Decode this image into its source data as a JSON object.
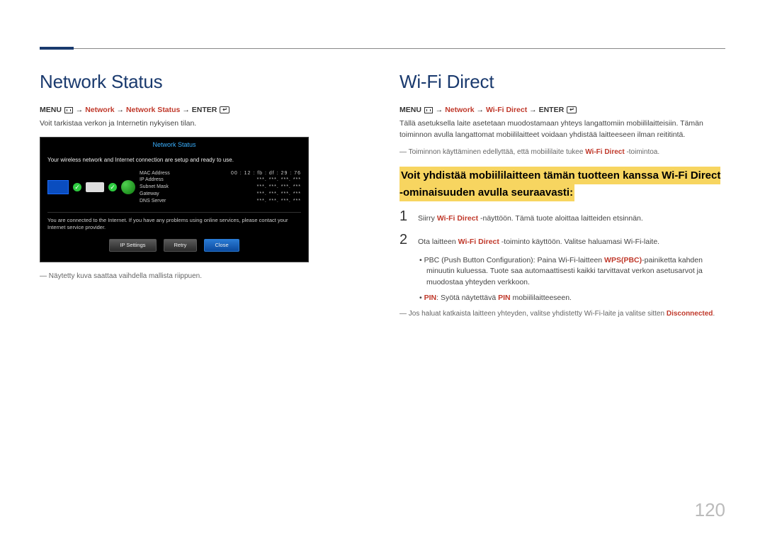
{
  "pageNumber": "120",
  "left": {
    "heading": "Network Status",
    "menuPath": {
      "prefix": "MENU ",
      "arrow": " → ",
      "net": "Network",
      "item": "Network Status",
      "enter": "ENTER"
    },
    "desc": "Voit tarkistaa verkon ja Internetin nykyisen tilan.",
    "note": "Näytetty kuva saattaa vaihdella mallista riippuen.",
    "window": {
      "title": "Network Status",
      "line1": "Your wireless network and Internet connection are setup and ready to use.",
      "info": {
        "mac_label": "MAC Address",
        "mac_val": "00 : 12 : fb : df : 29 : 76",
        "ip_label": "IP Address",
        "ip_val": "***. ***. ***. ***",
        "sub_label": "Subnet Mask",
        "sub_val": "***. ***. ***. ***",
        "gw_label": "Gateway",
        "gw_val": "***. ***. ***. ***",
        "dns_label": "DNS Server",
        "dns_val": "***. ***. ***. ***"
      },
      "msg": "You are connected to the Internet. If you have any problems using online services, please contact your Internet service provider.",
      "btn_ip": "IP Settings",
      "btn_retry": "Retry",
      "btn_close": "Close"
    }
  },
  "right": {
    "heading": "Wi-Fi Direct",
    "menuPath": {
      "prefix": "MENU ",
      "arrow": " → ",
      "net": "Network",
      "item": "Wi-Fi Direct",
      "enter": "ENTER"
    },
    "para1": "Tällä asetuksella laite asetetaan muodostamaan yhteys langattomiin mobiililaitteisiin. Tämän toiminnon avulla langattomat mobiililaitteet voidaan yhdistää laitteeseen ilman reititintä.",
    "note1_pre": "Toiminnon käyttäminen edellyttää, että mobiililaite tukee ",
    "note1_red": "Wi-Fi Direct",
    "note1_post": " -toimintoa.",
    "highlight": "Voit yhdistää mobiililaitteen tämän tuotteen kanssa Wi-Fi Direct -ominaisuuden avulla seuraavasti:",
    "step1_num": "1",
    "step1_pre": "Siirry ",
    "step1_red": "Wi-Fi Direct",
    "step1_post": " -näyttöön. Tämä tuote aloittaa laitteiden etsinnän.",
    "step2_num": "2",
    "step2_pre": "Ota laitteen ",
    "step2_red": "Wi-Fi Direct",
    "step2_post": " -toiminto käyttöön. Valitse haluamasi Wi-Fi-laite.",
    "bullet_pbc_pre": "PBC (Push Button Configuration): Paina Wi-Fi-laitteen ",
    "bullet_pbc_red": "WPS(PBC)",
    "bullet_pbc_post": "-painiketta kahden minuutin kuluessa. Tuote saa automaattisesti kaikki tarvittavat verkon asetusarvot ja muodostaa yhteyden verkkoon.",
    "bullet_pin_red": "PIN",
    "bullet_pin_mid": ": Syötä näytettävä ",
    "bullet_pin_red2": "PIN",
    "bullet_pin_post": " mobiililaitteeseen.",
    "note2_pre": "Jos haluat katkaista laitteen yhteyden, valitse yhdistetty Wi-Fi-laite ja valitse sitten ",
    "note2_red": "Disconnected",
    "note2_post": "."
  }
}
